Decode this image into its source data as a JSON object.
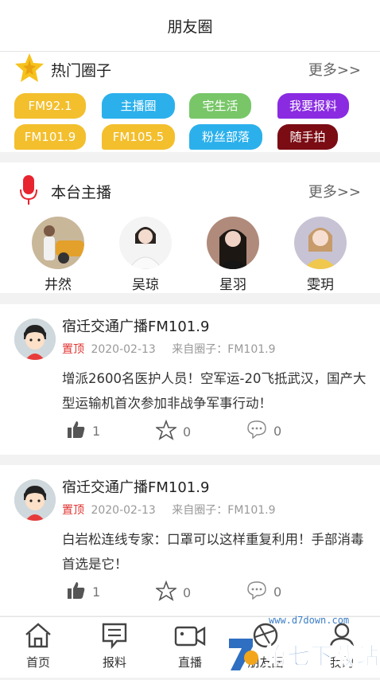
{
  "header": {
    "title": "朋友圈"
  },
  "hot_circles": {
    "title": "热门圈子",
    "more": "更多>>",
    "tags": [
      {
        "label": "FM92.1",
        "color": "#f3bf2d"
      },
      {
        "label": "主播圈",
        "color": "#2bb0ec"
      },
      {
        "label": "宅生活",
        "color": "#78c668"
      },
      {
        "label": "我要报料",
        "color": "#8a2be2"
      },
      {
        "label": "FM101.9",
        "color": "#f3bf2d"
      },
      {
        "label": "FM105.5",
        "color": "#f3bf2d"
      },
      {
        "label": "粉丝部落",
        "color": "#2bb0ec"
      },
      {
        "label": "随手拍",
        "color": "#7b0c14"
      }
    ]
  },
  "anchors": {
    "title": "本台主播",
    "more": "更多>>",
    "list": [
      {
        "name": "井然"
      },
      {
        "name": "吴琼"
      },
      {
        "name": "星羽"
      },
      {
        "name": "雯玥"
      }
    ]
  },
  "posts": [
    {
      "author": "宿迁交通广播FM101.9",
      "pin": "置顶",
      "date": "2020-02-13",
      "from": "来自圈子：FM101.9",
      "content": "增派2600名医护人员！空军运-20飞抵武汉，国产大型运输机首次参加非战争军事行动！",
      "likes": "1",
      "favorites": "0",
      "comments": "0"
    },
    {
      "author": "宿迁交通广播FM101.9",
      "pin": "置顶",
      "date": "2020-02-13",
      "from": "来自圈子：FM101.9",
      "content": "白岩松连线专家：口罩可以这样重复利用！手部消毒首选是它！",
      "likes": "1",
      "favorites": "0",
      "comments": "0"
    }
  ],
  "tabbar": [
    {
      "label": "首页",
      "icon": "home-icon"
    },
    {
      "label": "报料",
      "icon": "report-icon"
    },
    {
      "label": "直播",
      "icon": "live-icon"
    },
    {
      "label": "朋友圈",
      "icon": "moments-icon"
    },
    {
      "label": "我的",
      "icon": "profile-icon"
    }
  ],
  "watermark": {
    "text": "第七下载站",
    "url": "www.d7down.com"
  }
}
